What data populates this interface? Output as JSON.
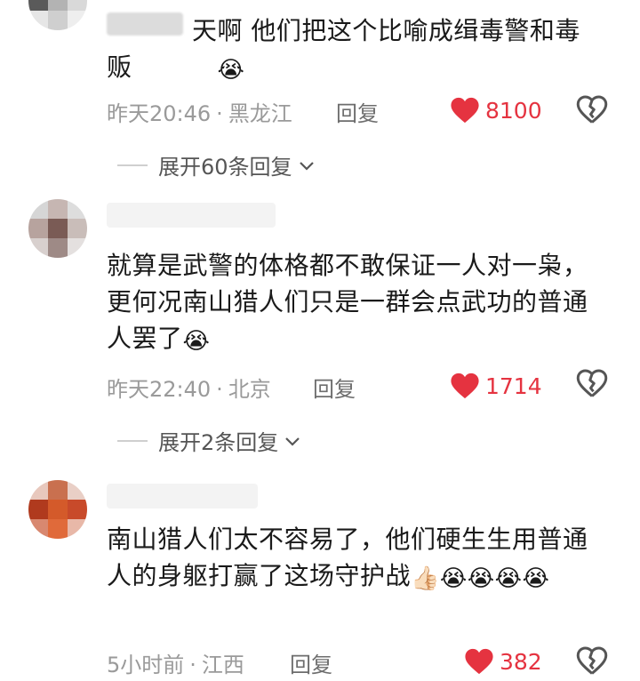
{
  "comments": [
    {
      "username": "·ust",
      "text": "天啊 他们把这个比喻成缉毒警和毒贩",
      "emojis": "😭",
      "time": "昨天20:46",
      "location": "黑龙江",
      "reply_label": "回复",
      "likes": "8100",
      "expand_label": "展开60条回复"
    },
    {
      "text": "就算是武警的体格都不敢保证一人对一枭，更何况南山猎人们只是一群会点武功的普通人罢了",
      "emojis": "😭",
      "time": "昨天22:40",
      "location": "北京",
      "reply_label": "回复",
      "likes": "1714",
      "expand_label": "展开2条回复"
    },
    {
      "text": "南山猎人们太不容易了，他们硬生生用普通人的身躯打赢了这场守护战",
      "emojis": "👍🏻😭😭😭😭",
      "time": "5小时前",
      "location": "江西",
      "reply_label": "回复",
      "likes": "382"
    }
  ],
  "colors": {
    "like": "#e53340",
    "meta": "#9a9a9a",
    "text": "#1a1a1a"
  },
  "icons": {
    "like": "heart-icon",
    "dislike": "broken-heart-icon",
    "expand": "chevron-down-icon"
  }
}
